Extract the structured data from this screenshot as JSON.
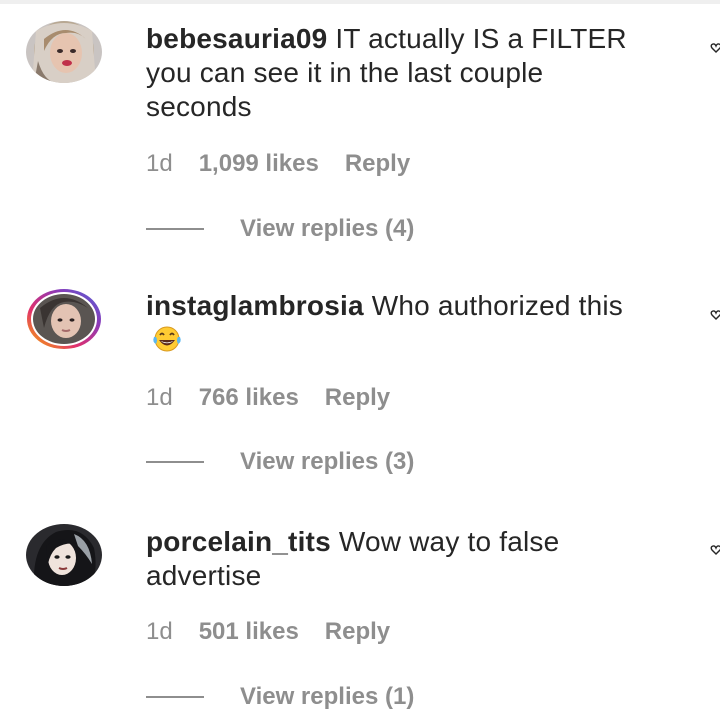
{
  "comments": [
    {
      "username": "bebesauria09",
      "text": " IT actually IS a FILTER you can see it in the last couple seconds",
      "time": "1d",
      "likes": "1,099 likes",
      "reply": "Reply",
      "view_replies": "View replies (4)",
      "avatar_icon": "profile-photo",
      "like_icon": "heart-icon"
    },
    {
      "username": "instaglambrosia",
      "text": " Who authorized this",
      "emoji_icon": "face-with-tears-of-joy-emoji",
      "time": "1d",
      "likes": "766 likes",
      "reply": "Reply",
      "view_replies": "View replies (3)",
      "avatar_icon": "profile-photo-story-ring",
      "like_icon": "heart-icon"
    },
    {
      "username": "porcelain_tits",
      "text": " Wow way to false advertise",
      "time": "1d",
      "likes": "501 likes",
      "reply": "Reply",
      "view_replies": "View replies (1)",
      "avatar_icon": "profile-photo",
      "like_icon": "heart-icon"
    }
  ],
  "colors": {
    "text": "#262626",
    "secondary": "#8e8e8e",
    "background": "#ffffff"
  }
}
